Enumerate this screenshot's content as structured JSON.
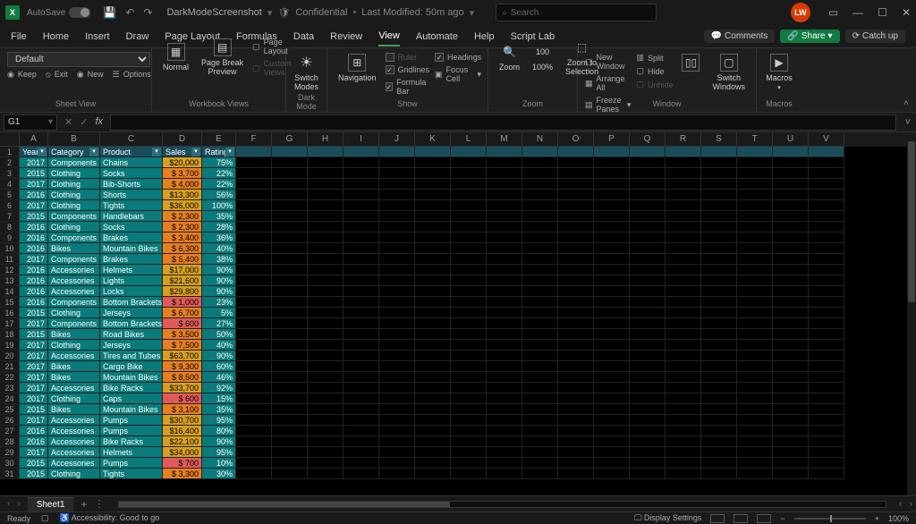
{
  "titlebar": {
    "autosave": "AutoSave",
    "docname": "DarkModeScreenshot",
    "sensitivity": "Confidential",
    "modified": "Last Modified: 50m ago",
    "search_placeholder": "Search",
    "avatar": "LW"
  },
  "tabs": {
    "file": "File",
    "home": "Home",
    "insert": "Insert",
    "draw": "Draw",
    "page_layout": "Page Layout",
    "formulas": "Formulas",
    "data": "Data",
    "review": "Review",
    "view": "View",
    "automate": "Automate",
    "help": "Help",
    "script_lab": "Script Lab",
    "comments": "Comments",
    "share": "Share",
    "catchup": "Catch up"
  },
  "ribbon": {
    "sheet_view": {
      "default": "Default",
      "keep": "Keep",
      "exit": "Exit",
      "new": "New",
      "options": "Options",
      "label": "Sheet View"
    },
    "wb_views": {
      "normal": "Normal",
      "pbp": "Page Break\nPreview",
      "page_layout": "Page Layout",
      "custom": "Custom Views",
      "label": "Workbook Views"
    },
    "dark": {
      "switch": "Switch\nModes",
      "label": "Dark Mode"
    },
    "show": {
      "nav": "Navigation",
      "ruler": "Ruler",
      "gridlines": "Gridlines",
      "formula_bar": "Formula Bar",
      "headings": "Headings",
      "focus": "Focus Cell",
      "label": "Show"
    },
    "zoom": {
      "zoom": "Zoom",
      "hundred": "100%",
      "selection": "Zoom to\nSelection",
      "label": "Zoom"
    },
    "window": {
      "new_window": "New Window",
      "arrange": "Arrange All",
      "freeze": "Freeze Panes",
      "split": "Split",
      "hide": "Hide",
      "unhide": "Unhide",
      "switch": "Switch\nWindows",
      "label": "Window"
    },
    "macros": {
      "macros": "Macros",
      "label": "Macros"
    }
  },
  "fbar": {
    "name": "G1"
  },
  "cols": [
    "A",
    "B",
    "C",
    "D",
    "E",
    "F",
    "G",
    "H",
    "I",
    "J",
    "K",
    "L",
    "M",
    "N",
    "O",
    "P",
    "Q",
    "R",
    "S",
    "T",
    "U",
    "V"
  ],
  "headers": {
    "year": "Year",
    "category": "Category",
    "product": "Product",
    "sales": "Sales",
    "rating": "Rating"
  },
  "rows": [
    {
      "n": 2,
      "y": "2017",
      "c": "Components",
      "p": "Chains",
      "s": "$20,000",
      "sc": "y",
      "r": "75%"
    },
    {
      "n": 3,
      "y": "2015",
      "c": "Clothing",
      "p": "Socks",
      "s": "$  3,700",
      "sc": "o",
      "r": "22%"
    },
    {
      "n": 4,
      "y": "2017",
      "c": "Clothing",
      "p": "Bib-Shorts",
      "s": "$  4,000",
      "sc": "o",
      "r": "22%"
    },
    {
      "n": 5,
      "y": "2016",
      "c": "Clothing",
      "p": "Shorts",
      "s": "$13,300",
      "sc": "y",
      "r": "56%"
    },
    {
      "n": 6,
      "y": "2017",
      "c": "Clothing",
      "p": "Tights",
      "s": "$36,000",
      "sc": "y",
      "r": "100%"
    },
    {
      "n": 7,
      "y": "2015",
      "c": "Components",
      "p": "Handlebars",
      "s": "$  2,300",
      "sc": "o",
      "r": "35%"
    },
    {
      "n": 8,
      "y": "2016",
      "c": "Clothing",
      "p": "Socks",
      "s": "$  2,300",
      "sc": "o",
      "r": "28%"
    },
    {
      "n": 9,
      "y": "2016",
      "c": "Components",
      "p": "Brakes",
      "s": "$  3,400",
      "sc": "o",
      "r": "36%"
    },
    {
      "n": 10,
      "y": "2016",
      "c": "Bikes",
      "p": "Mountain Bikes",
      "s": "$  6,300",
      "sc": "o",
      "r": "40%"
    },
    {
      "n": 11,
      "y": "2017",
      "c": "Components",
      "p": "Brakes",
      "s": "$  5,400",
      "sc": "o",
      "r": "38%"
    },
    {
      "n": 12,
      "y": "2016",
      "c": "Accessories",
      "p": "Helmets",
      "s": "$17,000",
      "sc": "y",
      "r": "90%"
    },
    {
      "n": 13,
      "y": "2016",
      "c": "Accessories",
      "p": "Lights",
      "s": "$21,600",
      "sc": "y",
      "r": "90%"
    },
    {
      "n": 14,
      "y": "2016",
      "c": "Accessories",
      "p": "Locks",
      "s": "$29,800",
      "sc": "y",
      "r": "90%"
    },
    {
      "n": 15,
      "y": "2016",
      "c": "Components",
      "p": "Bottom Brackets",
      "s": "$  1,000",
      "sc": "r",
      "r": "23%"
    },
    {
      "n": 16,
      "y": "2015",
      "c": "Clothing",
      "p": "Jerseys",
      "s": "$  6,700",
      "sc": "o",
      "r": "5%"
    },
    {
      "n": 17,
      "y": "2017",
      "c": "Components",
      "p": "Bottom Brackets",
      "s": "$     600",
      "sc": "r",
      "r": "27%"
    },
    {
      "n": 18,
      "y": "2015",
      "c": "Bikes",
      "p": "Road Bikes",
      "s": "$  3,500",
      "sc": "o",
      "r": "50%"
    },
    {
      "n": 19,
      "y": "2017",
      "c": "Clothing",
      "p": "Jerseys",
      "s": "$  7,500",
      "sc": "o",
      "r": "40%"
    },
    {
      "n": 20,
      "y": "2017",
      "c": "Accessories",
      "p": "Tires and Tubes",
      "s": "$63,700",
      "sc": "y",
      "r": "90%"
    },
    {
      "n": 21,
      "y": "2017",
      "c": "Bikes",
      "p": "Cargo Bike",
      "s": "$  9,300",
      "sc": "o",
      "r": "60%"
    },
    {
      "n": 22,
      "y": "2017",
      "c": "Bikes",
      "p": "Mountain Bikes",
      "s": "$  8,500",
      "sc": "o",
      "r": "46%"
    },
    {
      "n": 23,
      "y": "2017",
      "c": "Accessories",
      "p": "Bike Racks",
      "s": "$33,700",
      "sc": "y",
      "r": "92%"
    },
    {
      "n": 24,
      "y": "2017",
      "c": "Clothing",
      "p": "Caps",
      "s": "$     600",
      "sc": "r",
      "r": "15%"
    },
    {
      "n": 25,
      "y": "2015",
      "c": "Bikes",
      "p": "Mountain Bikes",
      "s": "$  3,100",
      "sc": "o",
      "r": "35%"
    },
    {
      "n": 26,
      "y": "2017",
      "c": "Accessories",
      "p": "Pumps",
      "s": "$30,700",
      "sc": "y",
      "r": "95%"
    },
    {
      "n": 27,
      "y": "2016",
      "c": "Accessories",
      "p": "Pumps",
      "s": "$16,400",
      "sc": "y",
      "r": "80%"
    },
    {
      "n": 28,
      "y": "2016",
      "c": "Accessories",
      "p": "Bike Racks",
      "s": "$22,100",
      "sc": "y",
      "r": "90%"
    },
    {
      "n": 29,
      "y": "2017",
      "c": "Accessories",
      "p": "Helmets",
      "s": "$34,000",
      "sc": "y",
      "r": "95%"
    },
    {
      "n": 30,
      "y": "2015",
      "c": "Accessories",
      "p": "Pumps",
      "s": "$     700",
      "sc": "r",
      "r": "10%"
    },
    {
      "n": 31,
      "y": "2015",
      "c": "Clothing",
      "p": "Tights",
      "s": "$  3,300",
      "sc": "o",
      "r": "30%"
    }
  ],
  "sheet": {
    "name": "Sheet1"
  },
  "status": {
    "ready": "Ready",
    "access": "Accessibility: Good to go",
    "display": "Display Settings",
    "zoom": "100%"
  }
}
